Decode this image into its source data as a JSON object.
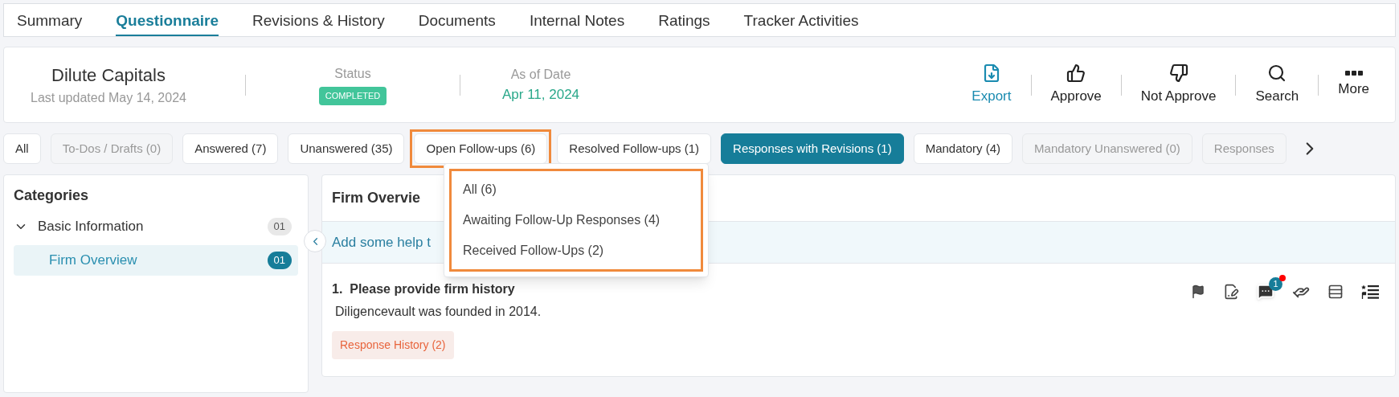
{
  "tabs": [
    {
      "label": "Summary",
      "selected": false
    },
    {
      "label": "Questionnaire",
      "selected": true
    },
    {
      "label": "Revisions & History",
      "selected": false
    },
    {
      "label": "Documents",
      "selected": false
    },
    {
      "label": "Internal Notes",
      "selected": false
    },
    {
      "label": "Ratings",
      "selected": false
    },
    {
      "label": "Tracker Activities",
      "selected": false
    }
  ],
  "header": {
    "company": "Dilute Capitals",
    "updated": "Last updated May 14, 2024",
    "status_label": "Status",
    "status": "COMPLETED",
    "date_label": "As of Date",
    "date": "Apr 11, 2024",
    "actions": [
      {
        "kind": "export",
        "label": "Export",
        "accent": true
      },
      {
        "kind": "approve",
        "label": "Approve",
        "accent": false
      },
      {
        "kind": "not_approve",
        "label": "Not Approve",
        "accent": false
      },
      {
        "kind": "search",
        "label": "Search",
        "accent": false
      },
      {
        "kind": "more",
        "label": "More",
        "accent": false
      }
    ]
  },
  "filters": [
    {
      "label": "All",
      "selected": false,
      "disabled": false,
      "highlighted": false
    },
    {
      "label": "To-Dos / Drafts (0)",
      "selected": false,
      "disabled": true,
      "highlighted": false
    },
    {
      "label": "Answered (7)",
      "selected": false,
      "disabled": false,
      "highlighted": false
    },
    {
      "label": "Unanswered (35)",
      "selected": false,
      "disabled": false,
      "highlighted": false
    },
    {
      "label": "Open Follow-ups (6)",
      "selected": false,
      "disabled": false,
      "highlighted": true
    },
    {
      "label": "Resolved Follow-ups (1)",
      "selected": false,
      "disabled": false,
      "highlighted": false
    },
    {
      "label": "Responses with Revisions (1)",
      "selected": true,
      "disabled": false,
      "highlighted": false
    },
    {
      "label": "Mandatory (4)",
      "selected": false,
      "disabled": false,
      "highlighted": false
    },
    {
      "label": "Mandatory Unanswered (0)",
      "selected": false,
      "disabled": true,
      "highlighted": false
    },
    {
      "label": "Responses",
      "selected": false,
      "disabled": true,
      "highlighted": false
    }
  ],
  "dropdown": {
    "highlighted": true,
    "items": [
      {
        "label": "All (6)"
      },
      {
        "label": "Awaiting Follow-Up Responses (4)"
      },
      {
        "label": "Received Follow-Ups (2)"
      }
    ]
  },
  "categories": {
    "title": "Categories",
    "items": [
      {
        "label": "Basic Information",
        "count": "01",
        "expanded": true,
        "selected": false,
        "children": [
          {
            "label": "Firm Overview",
            "count": "01",
            "selected": true
          }
        ]
      }
    ]
  },
  "section": {
    "title": "Firm Overvie",
    "help": "Add some help t",
    "question": {
      "number": "1.",
      "title": "Please provide firm history",
      "answer": "Diligencevault was founded in 2014.",
      "history": "Response History (2)",
      "comment_count": "1",
      "unread": true
    }
  }
}
